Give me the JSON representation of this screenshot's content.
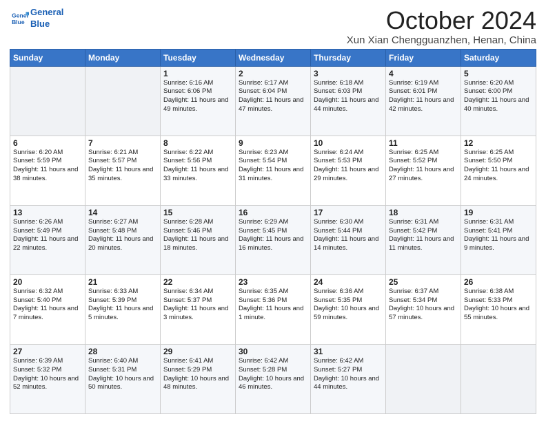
{
  "logo": {
    "line1": "General",
    "line2": "Blue"
  },
  "title": "October 2024",
  "subtitle": "Xun Xian Chengguanzhen, Henan, China",
  "weekdays": [
    "Sunday",
    "Monday",
    "Tuesday",
    "Wednesday",
    "Thursday",
    "Friday",
    "Saturday"
  ],
  "weeks": [
    [
      {
        "day": "",
        "info": ""
      },
      {
        "day": "",
        "info": ""
      },
      {
        "day": "1",
        "info": "Sunrise: 6:16 AM\nSunset: 6:06 PM\nDaylight: 11 hours and 49 minutes."
      },
      {
        "day": "2",
        "info": "Sunrise: 6:17 AM\nSunset: 6:04 PM\nDaylight: 11 hours and 47 minutes."
      },
      {
        "day": "3",
        "info": "Sunrise: 6:18 AM\nSunset: 6:03 PM\nDaylight: 11 hours and 44 minutes."
      },
      {
        "day": "4",
        "info": "Sunrise: 6:19 AM\nSunset: 6:01 PM\nDaylight: 11 hours and 42 minutes."
      },
      {
        "day": "5",
        "info": "Sunrise: 6:20 AM\nSunset: 6:00 PM\nDaylight: 11 hours and 40 minutes."
      }
    ],
    [
      {
        "day": "6",
        "info": "Sunrise: 6:20 AM\nSunset: 5:59 PM\nDaylight: 11 hours and 38 minutes."
      },
      {
        "day": "7",
        "info": "Sunrise: 6:21 AM\nSunset: 5:57 PM\nDaylight: 11 hours and 35 minutes."
      },
      {
        "day": "8",
        "info": "Sunrise: 6:22 AM\nSunset: 5:56 PM\nDaylight: 11 hours and 33 minutes."
      },
      {
        "day": "9",
        "info": "Sunrise: 6:23 AM\nSunset: 5:54 PM\nDaylight: 11 hours and 31 minutes."
      },
      {
        "day": "10",
        "info": "Sunrise: 6:24 AM\nSunset: 5:53 PM\nDaylight: 11 hours and 29 minutes."
      },
      {
        "day": "11",
        "info": "Sunrise: 6:25 AM\nSunset: 5:52 PM\nDaylight: 11 hours and 27 minutes."
      },
      {
        "day": "12",
        "info": "Sunrise: 6:25 AM\nSunset: 5:50 PM\nDaylight: 11 hours and 24 minutes."
      }
    ],
    [
      {
        "day": "13",
        "info": "Sunrise: 6:26 AM\nSunset: 5:49 PM\nDaylight: 11 hours and 22 minutes."
      },
      {
        "day": "14",
        "info": "Sunrise: 6:27 AM\nSunset: 5:48 PM\nDaylight: 11 hours and 20 minutes."
      },
      {
        "day": "15",
        "info": "Sunrise: 6:28 AM\nSunset: 5:46 PM\nDaylight: 11 hours and 18 minutes."
      },
      {
        "day": "16",
        "info": "Sunrise: 6:29 AM\nSunset: 5:45 PM\nDaylight: 11 hours and 16 minutes."
      },
      {
        "day": "17",
        "info": "Sunrise: 6:30 AM\nSunset: 5:44 PM\nDaylight: 11 hours and 14 minutes."
      },
      {
        "day": "18",
        "info": "Sunrise: 6:31 AM\nSunset: 5:42 PM\nDaylight: 11 hours and 11 minutes."
      },
      {
        "day": "19",
        "info": "Sunrise: 6:31 AM\nSunset: 5:41 PM\nDaylight: 11 hours and 9 minutes."
      }
    ],
    [
      {
        "day": "20",
        "info": "Sunrise: 6:32 AM\nSunset: 5:40 PM\nDaylight: 11 hours and 7 minutes."
      },
      {
        "day": "21",
        "info": "Sunrise: 6:33 AM\nSunset: 5:39 PM\nDaylight: 11 hours and 5 minutes."
      },
      {
        "day": "22",
        "info": "Sunrise: 6:34 AM\nSunset: 5:37 PM\nDaylight: 11 hours and 3 minutes."
      },
      {
        "day": "23",
        "info": "Sunrise: 6:35 AM\nSunset: 5:36 PM\nDaylight: 11 hours and 1 minute."
      },
      {
        "day": "24",
        "info": "Sunrise: 6:36 AM\nSunset: 5:35 PM\nDaylight: 10 hours and 59 minutes."
      },
      {
        "day": "25",
        "info": "Sunrise: 6:37 AM\nSunset: 5:34 PM\nDaylight: 10 hours and 57 minutes."
      },
      {
        "day": "26",
        "info": "Sunrise: 6:38 AM\nSunset: 5:33 PM\nDaylight: 10 hours and 55 minutes."
      }
    ],
    [
      {
        "day": "27",
        "info": "Sunrise: 6:39 AM\nSunset: 5:32 PM\nDaylight: 10 hours and 52 minutes."
      },
      {
        "day": "28",
        "info": "Sunrise: 6:40 AM\nSunset: 5:31 PM\nDaylight: 10 hours and 50 minutes."
      },
      {
        "day": "29",
        "info": "Sunrise: 6:41 AM\nSunset: 5:29 PM\nDaylight: 10 hours and 48 minutes."
      },
      {
        "day": "30",
        "info": "Sunrise: 6:42 AM\nSunset: 5:28 PM\nDaylight: 10 hours and 46 minutes."
      },
      {
        "day": "31",
        "info": "Sunrise: 6:42 AM\nSunset: 5:27 PM\nDaylight: 10 hours and 44 minutes."
      },
      {
        "day": "",
        "info": ""
      },
      {
        "day": "",
        "info": ""
      }
    ]
  ]
}
